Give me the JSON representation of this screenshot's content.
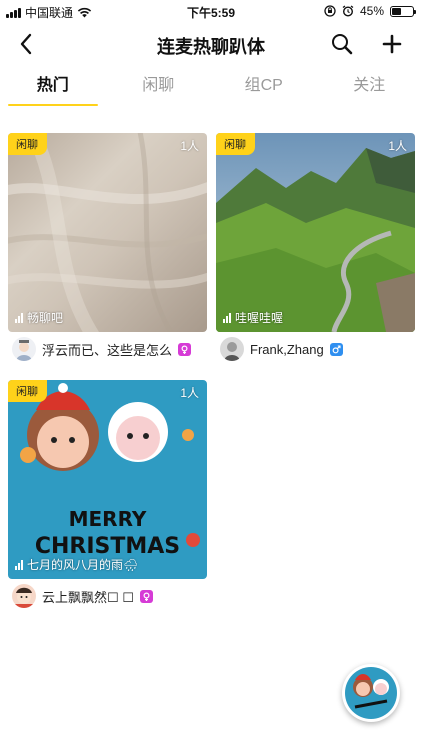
{
  "status_bar": {
    "carrier": "中国联通",
    "time": "下午5:59",
    "battery": "45%",
    "battery_level": 0.45
  },
  "nav": {
    "title": "连麦热聊趴体",
    "back_icon": "chevron-left-icon",
    "search_icon": "search-icon",
    "add_icon": "plus-icon"
  },
  "tabs": [
    {
      "label": "热门",
      "active": true
    },
    {
      "label": "闲聊",
      "active": false
    },
    {
      "label": "组CP",
      "active": false
    },
    {
      "label": "关注",
      "active": false
    }
  ],
  "rooms": [
    {
      "badge": "闲聊",
      "count": "1人",
      "name": "畅聊吧",
      "owner": "浮云而已、这些是怎么",
      "gender": "female",
      "gender_color": "#d63bd6"
    },
    {
      "badge": "闲聊",
      "count": "1人",
      "name": "哇喔哇喔",
      "owner": "Frank,Zhang",
      "gender": "male",
      "gender_color": "#2f8ff0"
    },
    {
      "badge": "闲聊",
      "count": "1人",
      "name": "七月的风八月的雨🌧",
      "owner": "云上飘飘然☐ ☐",
      "gender": "female",
      "gender_color": "#d63bd6",
      "image_text": [
        "MERRY",
        "CHRISTMAS"
      ]
    }
  ],
  "colors": {
    "accent": "#ffd21a",
    "female": "#d63bd6",
    "male": "#2f8ff0"
  }
}
